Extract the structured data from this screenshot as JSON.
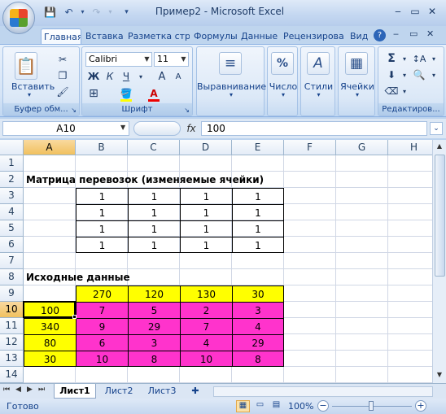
{
  "window": {
    "title": "Пример2 - Microsoft Excel",
    "minimize": "‒",
    "restore": "▭",
    "close": "✕"
  },
  "ribbon_tabs": [
    "Главная",
    "Вставка",
    "Разметка стр",
    "Формулы",
    "Данные",
    "Рецензирова",
    "Вид"
  ],
  "ribbon": {
    "clipboard": {
      "paste": "Вставить",
      "label": "Буфер обм..."
    },
    "font": {
      "name": "Calibri",
      "size": "11",
      "bold": "Ж",
      "italic": "К",
      "underline": "Ч",
      "grow": "A",
      "shrink": "A",
      "label": "Шрифт"
    },
    "alignment": {
      "label": "Выравнивание"
    },
    "number": {
      "label": "Число",
      "icon_text": "%"
    },
    "styles": {
      "label": "Стили"
    },
    "cells": {
      "label": "Ячейки"
    },
    "editing": {
      "label": "Редактиров..."
    }
  },
  "formula_bar": {
    "name_box": "A10",
    "fx": "fx",
    "value": "100"
  },
  "columns": [
    "A",
    "B",
    "C",
    "D",
    "E",
    "F",
    "G",
    "H"
  ],
  "rows": [
    "1",
    "2",
    "3",
    "4",
    "5",
    "6",
    "7",
    "8",
    "9",
    "10",
    "11",
    "12",
    "13",
    "14"
  ],
  "cells": {
    "r2_title": "Матрица перевозок (изменяемые ячейки)",
    "matrix": [
      [
        "1",
        "1",
        "1",
        "1"
      ],
      [
        "1",
        "1",
        "1",
        "1"
      ],
      [
        "1",
        "1",
        "1",
        "1"
      ],
      [
        "1",
        "1",
        "1",
        "1"
      ]
    ],
    "r8_title": "Исходные данные",
    "demand": [
      "270",
      "120",
      "130",
      "30"
    ],
    "supply": [
      "100",
      "340",
      "80",
      "30"
    ],
    "costs": [
      [
        "7",
        "5",
        "2",
        "3"
      ],
      [
        "9",
        "29",
        "7",
        "4"
      ],
      [
        "6",
        "3",
        "4",
        "29"
      ],
      [
        "10",
        "8",
        "10",
        "8"
      ]
    ]
  },
  "sheets": [
    "Лист1",
    "Лист2",
    "Лист3"
  ],
  "status": {
    "ready": "Готово",
    "zoom": "100%"
  },
  "colors": {
    "yellow": "#ffff00",
    "magenta": "#ff33cc",
    "selected_header": "#f1c15f"
  }
}
